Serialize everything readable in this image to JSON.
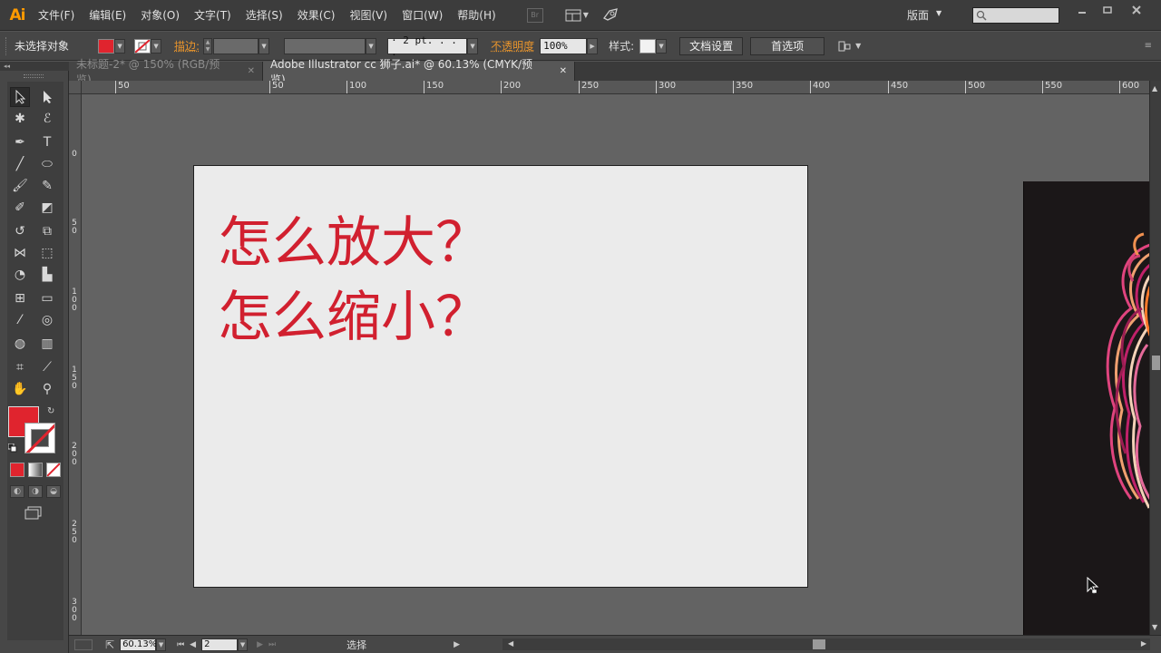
{
  "app": {
    "logo": "Ai"
  },
  "menu": [
    "文件(F)",
    "编辑(E)",
    "对象(O)",
    "文字(T)",
    "选择(S)",
    "效果(C)",
    "视图(V)",
    "窗口(W)",
    "帮助(H)"
  ],
  "menubar": {
    "bridge_label": "Br",
    "workspace": "版面",
    "search_placeholder": ""
  },
  "control": {
    "selection_status": "未选择对象",
    "fill_color": "#e0242e",
    "stroke_label": "描边:",
    "stroke_size": "· 2 pt. . . .",
    "opacity_label": "不透明度",
    "opacity_value": "100%",
    "style_label": "样式:",
    "doc_setup_button": "文档设置",
    "preferences_button": "首选项"
  },
  "tabs": [
    {
      "label": "未标题-2* @ 150% (RGB/预览)",
      "active": false
    },
    {
      "label": "Adobe Illustrator cc 狮子.ai* @ 60.13% (CMYK/预览)",
      "active": true
    }
  ],
  "ruler": {
    "h_ticks": [
      "50",
      "50",
      "100",
      "150",
      "200",
      "250",
      "300",
      "350",
      "400",
      "450",
      "500",
      "550",
      "600"
    ],
    "v_ticks": [
      "0",
      "50",
      "100",
      "150",
      "200",
      "250",
      "300"
    ]
  },
  "artboard": {
    "line1": "怎么放大？",
    "line2": "怎么缩小？",
    "text_color": "#d1202f"
  },
  "status": {
    "zoom": "60.13%",
    "artboard_number": "2",
    "tool_name": "选择"
  },
  "colors": {
    "accent_orange": "#ff9a00",
    "fill_red": "#e0242e"
  }
}
